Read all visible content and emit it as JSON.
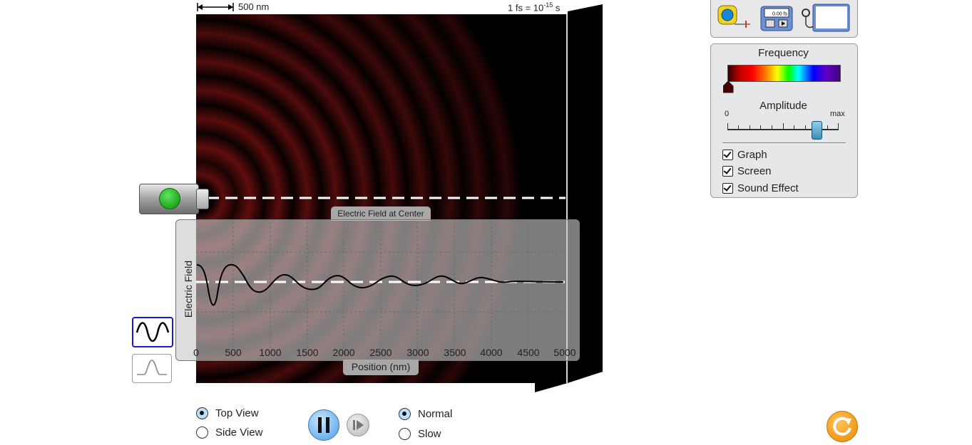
{
  "scale": {
    "length_label": "500 nm"
  },
  "time": {
    "prefix": "1 fs = 10",
    "exponent": "-15",
    "suffix": " s"
  },
  "graph": {
    "title": "Electric Field at Center",
    "y_label": "Electric Field",
    "x_label": "Position (nm)",
    "x_ticks": [
      "0",
      "500",
      "1000",
      "1500",
      "2000",
      "2500",
      "3000",
      "3500",
      "4000",
      "4500",
      "5000"
    ]
  },
  "tools": {
    "measuring_tape": "measuring-tape-icon",
    "stopwatch": "stopwatch-icon",
    "stopwatch_readout": "0.00 fs",
    "probe": "wave-probe-icon"
  },
  "controls": {
    "frequency_title": "Frequency",
    "frequency_level": 0.0,
    "amplitude_title": "Amplitude",
    "amplitude_min": "0",
    "amplitude_max": "max",
    "amplitude_level": 0.8,
    "checks": [
      {
        "label": "Graph",
        "checked": true
      },
      {
        "label": "Screen",
        "checked": true
      },
      {
        "label": "Sound Effect",
        "checked": true
      }
    ]
  },
  "view": {
    "top_label": "Top View",
    "side_label": "Side View",
    "selected": "Top View"
  },
  "speed": {
    "normal_label": "Normal",
    "slow_label": "Slow",
    "selected": "Normal"
  },
  "colors": {
    "accent": "#6fb3ee",
    "reset": "#f09a1a",
    "wave_selected_border": "#1a1acc"
  }
}
